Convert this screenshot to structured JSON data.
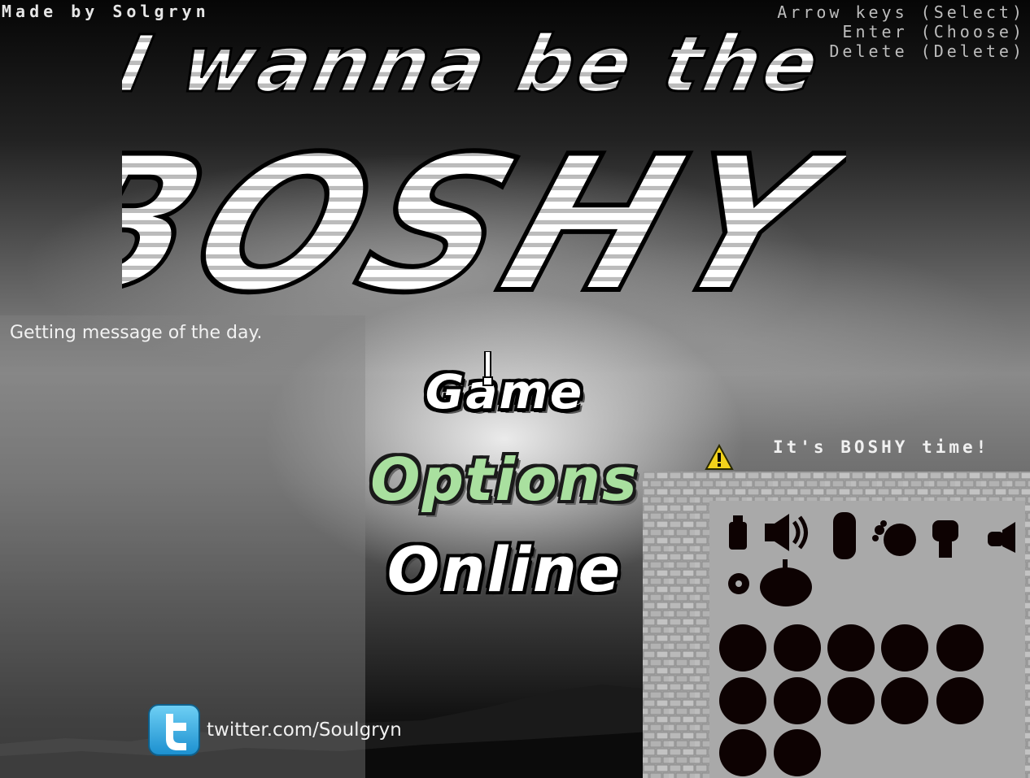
{
  "header": {
    "credit": "Made by Solgryn",
    "help_lines": [
      "Arrow keys (Select)",
      "Enter (Choose)",
      "Delete (Delete)"
    ]
  },
  "logo": {
    "line1": "I wanna be the",
    "line2": "BOSHY"
  },
  "motd": "Getting message of the day.",
  "menu": {
    "items": [
      "Game",
      "Options",
      "Online"
    ],
    "selected": "Options",
    "selected_color": "#a9e09f"
  },
  "notice": "It's BOSHY time!",
  "icons": {
    "collectibles": [
      "bottle-icon",
      "speaker-icon",
      "capsule-icon",
      "splat-icon",
      "fist-icon",
      "whistle-icon",
      "gear-icon",
      "pumpkin-icon"
    ],
    "slots_filled": 12
  },
  "social": {
    "twitter": "twitter.com/Soulgryn"
  }
}
